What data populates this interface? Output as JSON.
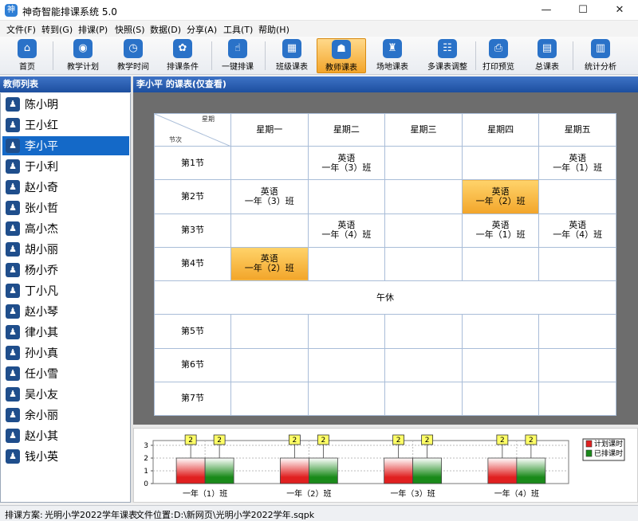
{
  "window": {
    "title": "神奇智能排课系统 5.0",
    "minimize": "—",
    "maximize": "☐",
    "close": "✕"
  },
  "menu": [
    "文件(F)",
    "转到(G)",
    "排课(P)",
    "快照(S)",
    "数据(D)",
    "分享(A)",
    "工具(T)",
    "帮助(H)"
  ],
  "toolbar": [
    {
      "label": "首页",
      "icon": "home-icon",
      "glyph": "⌂"
    },
    {
      "label": "教学计划",
      "icon": "teaching-plan-icon",
      "glyph": "◉"
    },
    {
      "label": "教学时间",
      "icon": "clock-icon",
      "glyph": "◷"
    },
    {
      "label": "排课条件",
      "icon": "conditions-icon",
      "glyph": "✿"
    },
    {
      "label": "一键排课",
      "icon": "one-click-icon",
      "glyph": "☝"
    },
    {
      "label": "班级课表",
      "icon": "class-timetable-icon",
      "glyph": "▦"
    },
    {
      "label": "教师课表",
      "icon": "teacher-timetable-icon",
      "glyph": "☗",
      "active": true
    },
    {
      "label": "场地课表",
      "icon": "venue-timetable-icon",
      "glyph": "♜"
    },
    {
      "label": "多课表调整",
      "icon": "multi-timetable-icon",
      "glyph": "☷"
    },
    {
      "label": "打印预览",
      "icon": "printer-icon",
      "glyph": "⎙"
    },
    {
      "label": "总课表",
      "icon": "master-timetable-icon",
      "glyph": "▤"
    },
    {
      "label": "统计分析",
      "icon": "statistics-icon",
      "glyph": "▥"
    }
  ],
  "left_panel": {
    "title": "教师列表",
    "teachers": [
      "陈小明",
      "王小红",
      "李小平",
      "于小利",
      "赵小奇",
      "张小哲",
      "高小杰",
      "胡小丽",
      "杨小乔",
      "丁小凡",
      "赵小琴",
      "律小其",
      "孙小真",
      "任小雪",
      "吴小友",
      "余小丽",
      "赵小其",
      "钱小英"
    ],
    "selected": "李小平"
  },
  "timetable": {
    "title": "李小平 的课表(仅查看)",
    "corner_top": "星期",
    "corner_bottom": "节次",
    "days": [
      "星期一",
      "星期二",
      "星期三",
      "星期四",
      "星期五"
    ],
    "lunch": "午休",
    "periods": [
      {
        "name": "第1节",
        "cells": [
          null,
          {
            "subject": "英语",
            "class": "一年（3）班"
          },
          null,
          null,
          {
            "subject": "英语",
            "class": "一年（1）班"
          }
        ]
      },
      {
        "name": "第2节",
        "cells": [
          {
            "subject": "英语",
            "class": "一年（3）班"
          },
          null,
          null,
          {
            "subject": "英语",
            "class": "一年（2）班",
            "highlight": true
          },
          null
        ]
      },
      {
        "name": "第3节",
        "cells": [
          null,
          {
            "subject": "英语",
            "class": "一年（4）班"
          },
          null,
          {
            "subject": "英语",
            "class": "一年（1）班"
          },
          {
            "subject": "英语",
            "class": "一年（4）班"
          }
        ]
      },
      {
        "name": "第4节",
        "cells": [
          {
            "subject": "英语",
            "class": "一年（2）班",
            "highlight": true
          },
          null,
          null,
          null,
          null
        ]
      },
      {
        "name": "第5节",
        "cells": [
          null,
          null,
          null,
          null,
          null
        ]
      },
      {
        "name": "第6节",
        "cells": [
          null,
          null,
          null,
          null,
          null
        ]
      },
      {
        "name": "第7节",
        "cells": [
          null,
          null,
          null,
          null,
          null
        ]
      }
    ]
  },
  "chart_data": {
    "type": "bar",
    "categories": [
      "一年（1）班",
      "一年（2）班",
      "一年（3）班",
      "一年（4）班"
    ],
    "series": [
      {
        "name": "计划课时",
        "values": [
          2,
          2,
          2,
          2
        ],
        "color": "#e02020"
      },
      {
        "name": "已排课时",
        "values": [
          2,
          2,
          2,
          2
        ],
        "color": "#1a8a1a"
      }
    ],
    "ylim": [
      0,
      3
    ],
    "yticks": [
      0,
      1,
      2,
      3
    ],
    "data_labels": true,
    "legend_position": "right"
  },
  "status": {
    "scheme_label": "排课方案:",
    "scheme": "光明小学2022学年课表",
    "file_label": "文件位置:",
    "file_path": "D:\\新网页\\光明小学2022学年.sqpk"
  },
  "colors": {
    "header_blue": "#1d4f9f",
    "selected_blue": "#1469c8",
    "highlight_orange": "#f2a52a"
  }
}
